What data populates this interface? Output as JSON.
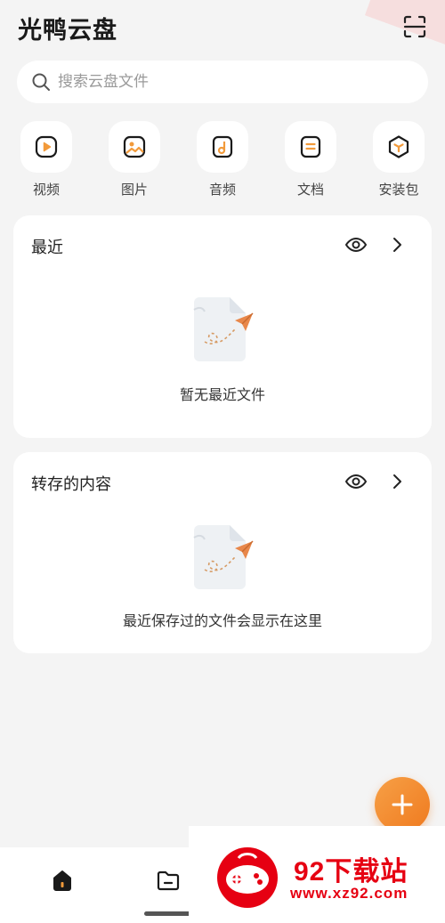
{
  "app": {
    "title": "光鸭云盘"
  },
  "icons": {
    "scan": "scan-icon",
    "search": "search-icon",
    "eye": "eye-icon",
    "chevron": "chevron-right-icon",
    "add": "plus-icon",
    "home": "home-icon",
    "folder": "folder-icon"
  },
  "search": {
    "placeholder": "搜索云盘文件"
  },
  "categories": [
    {
      "label": "视频",
      "icon": "video-icon"
    },
    {
      "label": "图片",
      "icon": "image-icon"
    },
    {
      "label": "音频",
      "icon": "audio-icon"
    },
    {
      "label": "文档",
      "icon": "document-icon"
    },
    {
      "label": "安装包",
      "icon": "package-icon"
    }
  ],
  "recent": {
    "title": "最近",
    "empty_text": "暂无最近文件"
  },
  "saved": {
    "title": "转存的内容",
    "empty_text": "最近保存过的文件会显示在这里"
  },
  "watermark": {
    "title": "92下载站",
    "url": "www.xz92.com"
  },
  "colors": {
    "accent": "#ef7a1f",
    "watermark": "#e60012",
    "background": "#f4f4f4"
  }
}
